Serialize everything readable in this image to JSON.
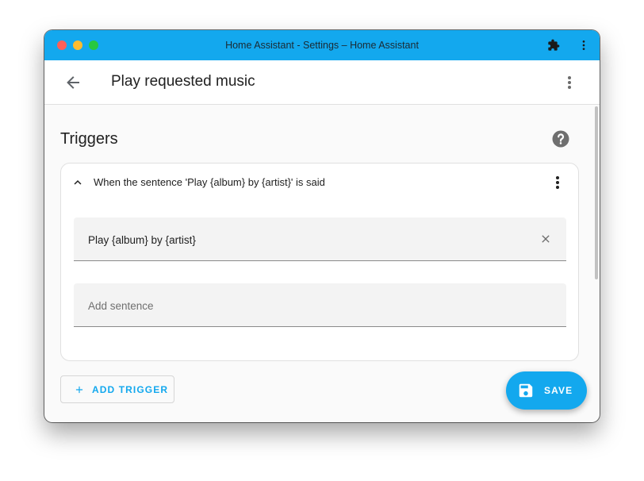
{
  "window": {
    "title": "Home Assistant - Settings – Home Assistant",
    "controls": [
      "close",
      "minimize",
      "maximize"
    ],
    "toolbar_icons": [
      "extension-icon",
      "more-vert-icon"
    ]
  },
  "appbar": {
    "back_icon": "arrow-left-icon",
    "title": "Play requested music",
    "menu_icon": "more-vert-icon"
  },
  "section": {
    "title": "Triggers",
    "help_icon": "help-circle-icon"
  },
  "trigger_card": {
    "expand_icon": "chevron-up-icon",
    "title": "When the sentence 'Play {album} by {artist}' is said",
    "menu_icon": "more-vert-icon",
    "sentences": [
      {
        "value": "Play {album} by {artist}",
        "clear_icon": "close-icon"
      }
    ],
    "new_sentence": {
      "value": "",
      "placeholder": "Add sentence"
    }
  },
  "actions": {
    "add_trigger_label": "ADD TRIGGER",
    "add_trigger_icon": "plus-icon",
    "save_label": "SAVE",
    "save_icon": "floppy-disk-icon"
  },
  "colors": {
    "accent": "#13a8ee",
    "titlebar": "#13a8ee",
    "background": "#fafafa"
  }
}
